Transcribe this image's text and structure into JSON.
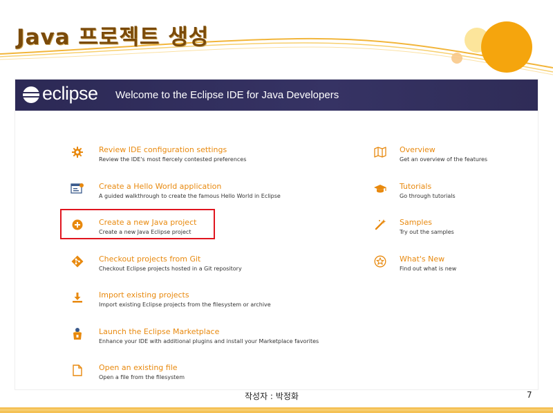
{
  "slide": {
    "title": "Java 프로젝트 생성",
    "author": "작성자 : 박정화",
    "page_number": "7"
  },
  "colors": {
    "accent_orange": "#e8890e",
    "header_bg": "#2f2c57",
    "highlight_red": "#e0141e",
    "deco_orange": "#f5a50d"
  },
  "welcome": {
    "brand": "eclipse",
    "title": "Welcome to the Eclipse IDE for Java Developers",
    "left_items": [
      {
        "icon": "gear-icon",
        "title": "Review IDE configuration settings",
        "desc": "Review the IDE's most fiercely contested preferences"
      },
      {
        "icon": "hello-world-icon",
        "title": "Create a Hello World application",
        "desc": "A guided walkthrough to create the famous Hello World in Eclipse"
      },
      {
        "icon": "plus-circle-icon",
        "title": "Create a new Java project",
        "desc": "Create a new Java Eclipse project"
      },
      {
        "icon": "git-icon",
        "title": "Checkout projects from Git",
        "desc": "Checkout Eclipse projects hosted in a Git repository"
      },
      {
        "icon": "import-icon",
        "title": "Import existing projects",
        "desc": "Import existing Eclipse projects from the filesystem or archive"
      },
      {
        "icon": "marketplace-icon",
        "title": "Launch the Eclipse Marketplace",
        "desc": "Enhance your IDE with additional plugins and install your Marketplace favorites"
      },
      {
        "icon": "file-icon",
        "title": "Open an existing file",
        "desc": "Open a file from the filesystem"
      }
    ],
    "right_items": [
      {
        "icon": "map-icon",
        "title": "Overview",
        "desc": "Get an overview of the features"
      },
      {
        "icon": "graduation-cap-icon",
        "title": "Tutorials",
        "desc": "Go through tutorials"
      },
      {
        "icon": "magic-wand-icon",
        "title": "Samples",
        "desc": "Try out the samples"
      },
      {
        "icon": "star-badge-icon",
        "title": "What's New",
        "desc": "Find out what is new"
      }
    ]
  }
}
